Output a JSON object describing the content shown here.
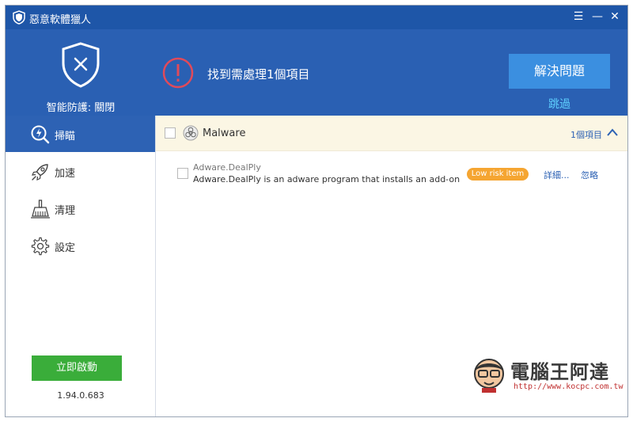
{
  "window": {
    "title": "惡意軟體獵人",
    "menu_glyph": "☰",
    "minimize_glyph": "—",
    "close_glyph": "✕"
  },
  "header": {
    "protection_status": "智能防護: 關閉",
    "alert_text": "找到需處理1個項目",
    "resolve_button": "解決問題",
    "skip_link": "跳過"
  },
  "sidebar": {
    "items": [
      {
        "label": "掃瞄",
        "icon": "scan-icon",
        "active": true
      },
      {
        "label": "加速",
        "icon": "rocket-icon",
        "active": false
      },
      {
        "label": "清理",
        "icon": "broom-icon",
        "active": false
      },
      {
        "label": "設定",
        "icon": "gear-icon",
        "active": false
      }
    ],
    "start_button": "立即啟動",
    "version": "1.94.0.683"
  },
  "results": {
    "group": {
      "label": "Malware",
      "count": "1個項目"
    },
    "items": [
      {
        "name": "Adware.DealPly",
        "description": "Adware.DealPly is an adware program that installs an add-on for We...",
        "risk": "Low risk item",
        "details_link": "詳細...",
        "ignore_link": "忽略"
      }
    ]
  },
  "watermark": {
    "text": "電腦王阿達",
    "url": "http://www.kocpc.com.tw"
  },
  "colors": {
    "header_blue": "#2a60b3",
    "titlebar_blue": "#1e56a8",
    "accent_button": "#3b8fe0",
    "start_green": "#3aad3a",
    "risk_orange": "#f5a531",
    "alert_red": "#e04a5a"
  }
}
